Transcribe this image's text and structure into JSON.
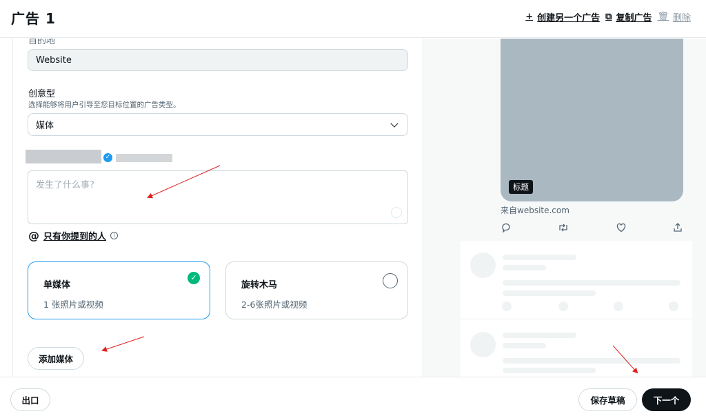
{
  "header": {
    "title": "广告 1",
    "create_another_label": "创建另一个广告",
    "copy_label": "复制广告",
    "delete_label": "删除"
  },
  "form": {
    "destination_label_cut": "目的地",
    "destination_value": "Website",
    "creative_label": "创意型",
    "creative_sublabel": "选择能够将用户引导至您目标位置的广告类型。",
    "creative_value": "媒体",
    "compose_placeholder": "发生了什么事?",
    "reply_label": "只有你提到的人",
    "cards": [
      {
        "title": "单媒体",
        "desc": "1 张照片或视频",
        "selected": true
      },
      {
        "title": "旋转木马",
        "desc": "2-6张照片或视频",
        "selected": false
      }
    ],
    "add_media_label": "添加媒体"
  },
  "preview": {
    "media_tag": "标题",
    "from_text": "来自website.com",
    "icons": [
      "reply-icon",
      "retweet-icon",
      "like-icon",
      "share-icon"
    ]
  },
  "footer": {
    "exit_label": "出口",
    "save_draft_label": "保存草稿",
    "next_label": "下一个"
  },
  "colors": {
    "accent": "#1d9bf0",
    "success": "#00ba7c",
    "dark": "#0f1419",
    "annotation_arrow": "#e02020"
  }
}
